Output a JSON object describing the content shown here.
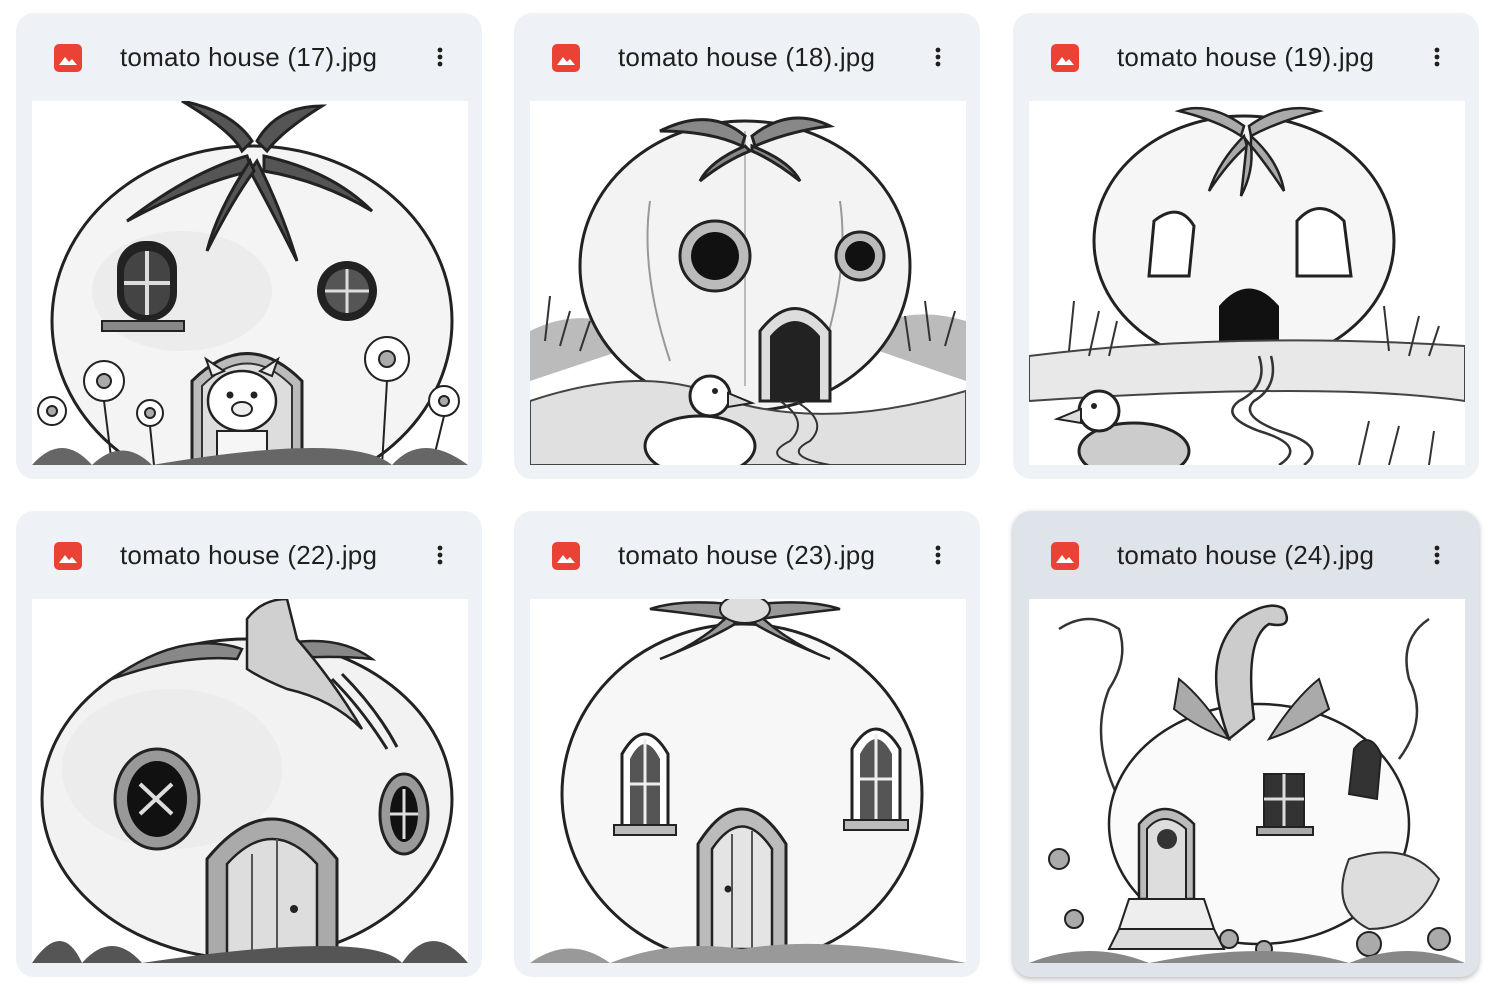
{
  "files": [
    {
      "name": "tomato house (17).jpg",
      "icon": "image-file-icon",
      "menu_icon": "more-vert-icon"
    },
    {
      "name": "tomato house (18).jpg",
      "icon": "image-file-icon",
      "menu_icon": "more-vert-icon"
    },
    {
      "name": "tomato house (19).jpg",
      "icon": "image-file-icon",
      "menu_icon": "more-vert-icon"
    },
    {
      "name": "tomato house (22).jpg",
      "icon": "image-file-icon",
      "menu_icon": "more-vert-icon"
    },
    {
      "name": "tomato house (23).jpg",
      "icon": "image-file-icon",
      "menu_icon": "more-vert-icon"
    },
    {
      "name": "tomato house (24).jpg",
      "icon": "image-file-icon",
      "menu_icon": "more-vert-icon",
      "selected": true
    }
  ],
  "colors": {
    "card_bg": "#eef1f6",
    "card_selected_bg": "#dfe3ea",
    "file_icon": "#ea4335",
    "text": "#1f1f1f"
  }
}
